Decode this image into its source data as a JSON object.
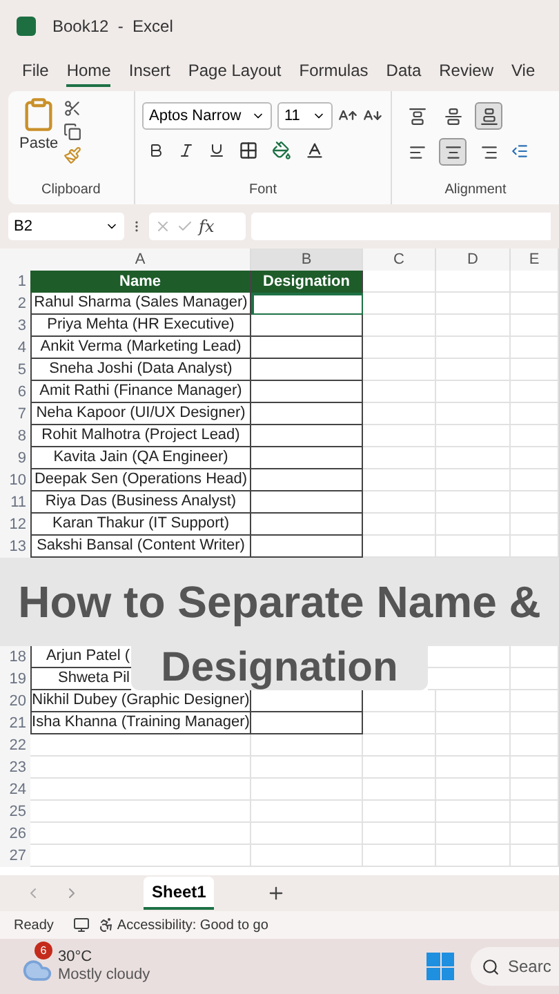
{
  "window": {
    "title": "Book12  -  Excel"
  },
  "tabs": [
    {
      "label": "File",
      "selected": false
    },
    {
      "label": "Home",
      "selected": true
    },
    {
      "label": "Insert",
      "selected": false
    },
    {
      "label": "Page Layout",
      "selected": false
    },
    {
      "label": "Formulas",
      "selected": false
    },
    {
      "label": "Data",
      "selected": false
    },
    {
      "label": "Review",
      "selected": false
    },
    {
      "label": "Vie",
      "selected": false
    }
  ],
  "ribbon": {
    "paste": "Paste",
    "clipboard_group": "Clipboard",
    "font_name": "Aptos Narrow",
    "font_size": "11",
    "font_group": "Font",
    "alignment_group": "Alignment",
    "vertical_align": [
      {
        "kind": "top",
        "selected": false
      },
      {
        "kind": "middle",
        "selected": false
      },
      {
        "kind": "bottom",
        "selected": true
      }
    ],
    "horizontal_align": [
      {
        "kind": "left",
        "selected": false
      },
      {
        "kind": "center",
        "selected": true
      },
      {
        "kind": "right",
        "selected": false
      }
    ]
  },
  "formula_bar": {
    "name_box": "B2",
    "fx": "fx"
  },
  "columns": [
    "A",
    "B",
    "C",
    "D",
    "E"
  ],
  "header_row": {
    "number": "1",
    "cells": [
      "Name",
      "Designation"
    ]
  },
  "rows": [
    {
      "number": "2",
      "name": "Rahul Sharma (Sales Manager)",
      "selected": true
    },
    {
      "number": "3",
      "name": "Priya Mehta (HR Executive)",
      "selected": false
    },
    {
      "number": "4",
      "name": "Ankit Verma (Marketing Lead)",
      "selected": false
    },
    {
      "number": "5",
      "name": "Sneha Joshi (Data Analyst)",
      "selected": false
    },
    {
      "number": "6",
      "name": "Amit Rathi (Finance Manager)",
      "selected": false
    },
    {
      "number": "7",
      "name": "Neha Kapoor (UI/UX Designer)",
      "selected": false
    },
    {
      "number": "8",
      "name": "Rohit Malhotra (Project Lead)",
      "selected": false
    },
    {
      "number": "9",
      "name": "Kavita Jain (QA Engineer)",
      "selected": false
    },
    {
      "number": "10",
      "name": "Deepak Sen (Operations Head)",
      "selected": false
    },
    {
      "number": "11",
      "name": "Riya Das (Business Analyst)",
      "selected": false
    },
    {
      "number": "12",
      "name": "Karan Thakur (IT Support)",
      "selected": false
    },
    {
      "number": "13",
      "name": "Sakshi Bansal (Content Writer)",
      "selected": false
    }
  ],
  "caption_lines": [
    "How to Separate Name &",
    "Designation"
  ],
  "rows_beside_caption": [
    {
      "number": "18",
      "name": "Arjun Patel ("
    },
    {
      "number": "19",
      "name": "Shweta Pil"
    }
  ],
  "rows_after_caption": [
    {
      "number": "20",
      "name": "Nikhil Dubey (Graphic Designer)",
      "selected": false
    },
    {
      "number": "21",
      "name": "Isha Khanna (Training Manager)",
      "selected": false
    }
  ],
  "empty_rows": [
    "22",
    "23",
    "24",
    "25",
    "26",
    "27"
  ],
  "sheet_tabs": [
    {
      "label": "Sheet1",
      "selected": true
    }
  ],
  "status_bar": {
    "mode": "Ready",
    "accessibility": "Accessibility: Good to go"
  },
  "taskbar": {
    "badge": "6",
    "temperature": "30°C",
    "weather": "Mostly cloudy",
    "search": "Searc"
  }
}
